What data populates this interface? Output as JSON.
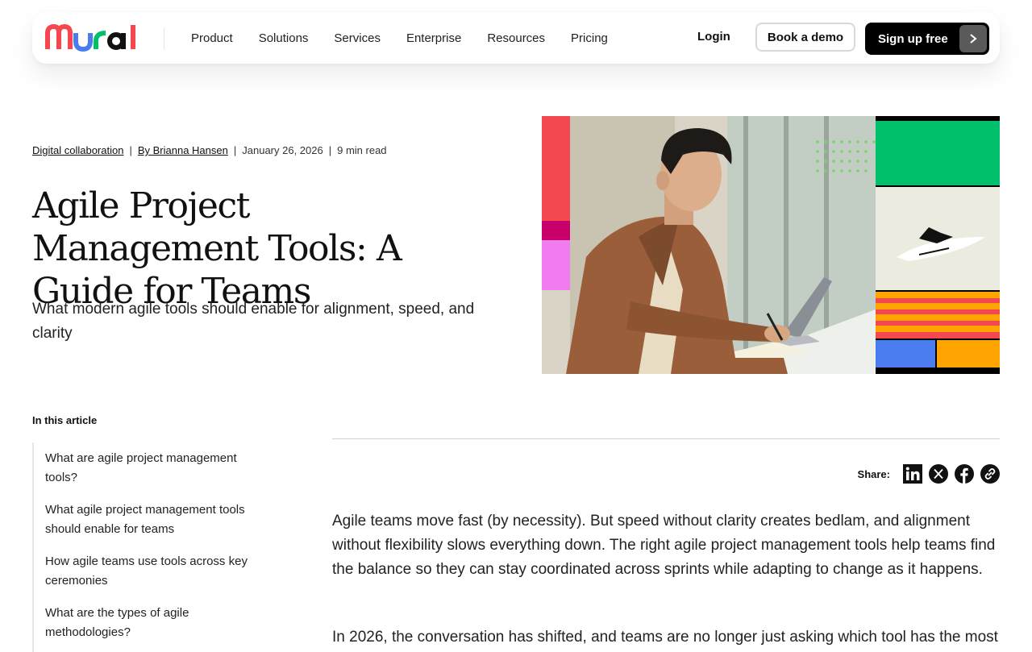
{
  "brand": {
    "logo_text": "mural"
  },
  "nav": {
    "items": [
      "Product",
      "Solutions",
      "Services",
      "Enterprise",
      "Resources",
      "Pricing"
    ],
    "login": "Login",
    "book_demo": "Book a demo",
    "sign_up": "Sign up free"
  },
  "article": {
    "category": "Digital collaboration",
    "author": "By Brianna Hansen",
    "date": "January 26, 2026",
    "read_time": "9 min read",
    "title": "Agile Project Management Tools: A Guide for Teams",
    "subtitle": "What modern agile tools should enable for alignment, speed, and clarity",
    "paragraphs": [
      "Agile teams move fast (by necessity). But speed without clarity creates bedlam, and alignment without flexibility slows everything down. The right agile project management tools help teams find the balance so they can stay coordinated across sprints while adapting to change as it happens.",
      "In 2026, the conversation has shifted, and teams are no longer just asking which tool has the most"
    ]
  },
  "toc": {
    "title": "In this article",
    "items": [
      "What are agile project management tools?",
      "What agile project management tools should enable for teams",
      "How agile teams use tools across key ceremonies",
      "What are the types of agile methodologies?"
    ]
  },
  "share": {
    "label": "Share:",
    "icons": [
      "linkedin-icon",
      "x-icon",
      "facebook-icon",
      "link-icon"
    ]
  },
  "colors": {
    "accent_red": "#F4474F",
    "accent_blue": "#4A7CF0",
    "accent_green": "#00C06B",
    "accent_orange": "#FFA400",
    "accent_pink": "#F07CF0",
    "dark_button": "#000000"
  }
}
